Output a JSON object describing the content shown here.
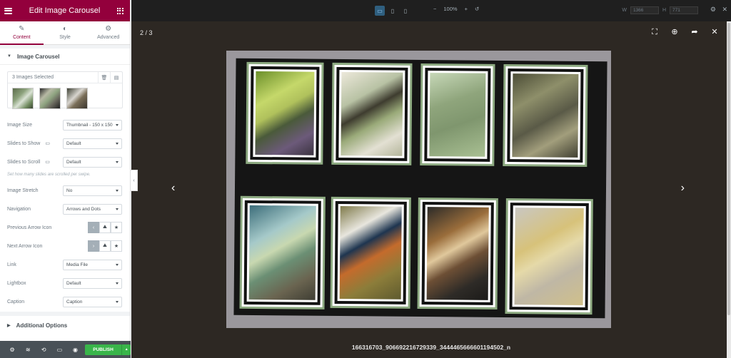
{
  "sidebar": {
    "header_title": "Edit Image Carousel",
    "tabs": [
      {
        "label": "Content",
        "icon": "pencil-icon"
      },
      {
        "label": "Style",
        "icon": "half-circle-icon"
      },
      {
        "label": "Advanced",
        "icon": "gear-icon"
      }
    ],
    "section_title": "Image Carousel",
    "gallery": {
      "count_label": "3 Images Selected"
    },
    "controls": {
      "image_size": {
        "label": "Image Size",
        "value": "Thumbnail - 150 x 150"
      },
      "slides_to_show": {
        "label": "Slides to Show",
        "value": "Default"
      },
      "slides_to_scroll": {
        "label": "Slides to Scroll",
        "value": "Default",
        "helper": "Set how many slides are scrolled per swipe."
      },
      "image_stretch": {
        "label": "Image Stretch",
        "value": "No"
      },
      "navigation": {
        "label": "Navigation",
        "value": "Arrows and Dots"
      },
      "previous_arrow_icon": {
        "label": "Previous Arrow Icon"
      },
      "next_arrow_icon": {
        "label": "Next Arrow Icon"
      },
      "link": {
        "label": "Link",
        "value": "Media File"
      },
      "lightbox": {
        "label": "Lightbox",
        "value": "Default"
      },
      "caption": {
        "label": "Caption",
        "value": "Caption"
      }
    },
    "additional_options": "Additional Options",
    "publish_label": "PUBLISH"
  },
  "topbar": {
    "zoom": "100%",
    "width_label": "W",
    "width_value": "1366",
    "height_label": "H",
    "height_value": "771"
  },
  "lightbox": {
    "counter": "2 / 3",
    "caption": "166316703_906692216729339_3444465666601194502_n"
  },
  "colors": {
    "brand": "#93003c",
    "publish": "#39b54a",
    "footer": "#495157",
    "lightbox_bg": "#2d2823"
  }
}
